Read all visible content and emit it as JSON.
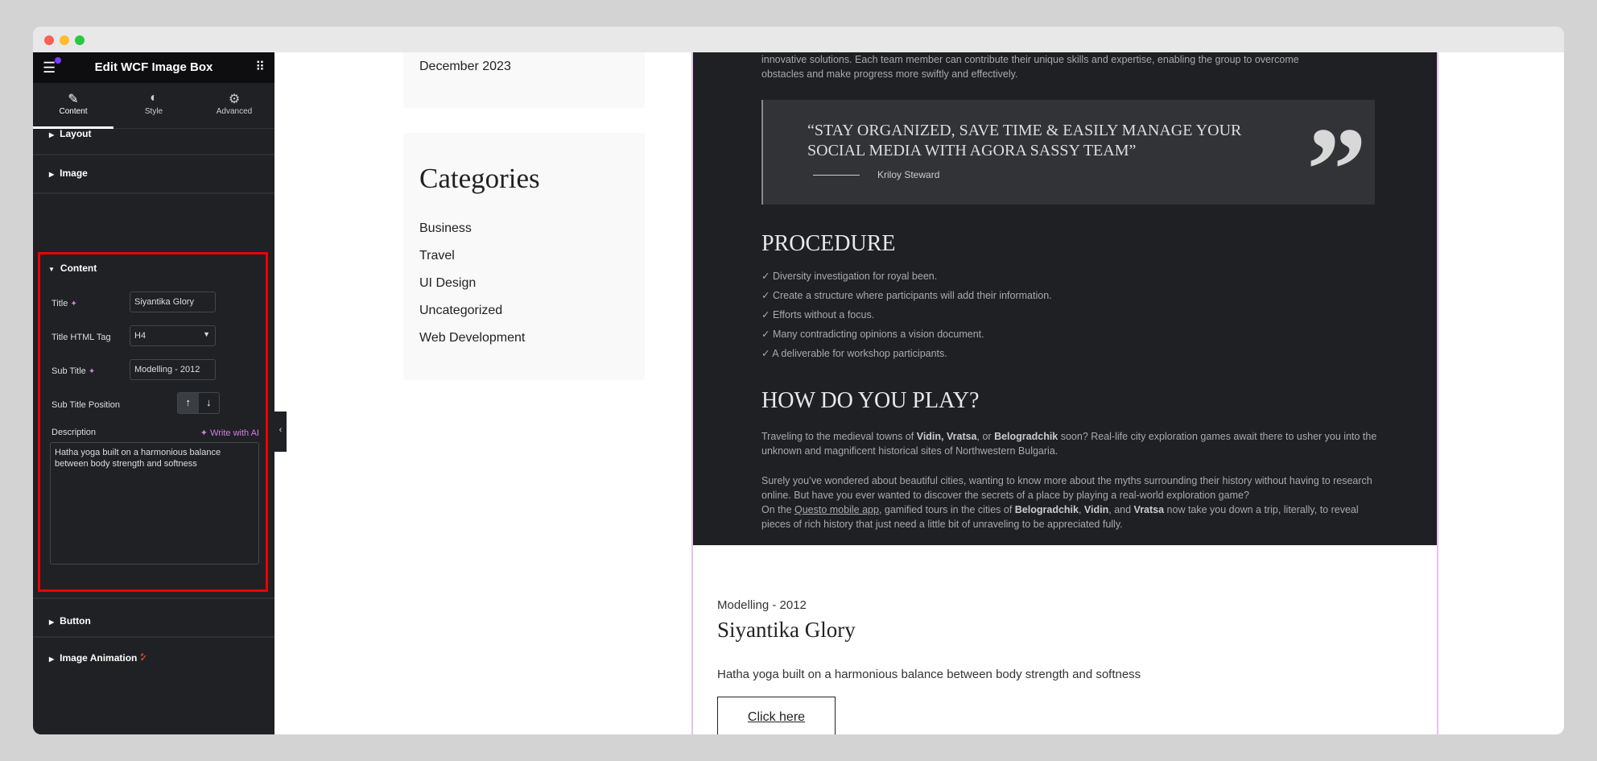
{
  "sidebar": {
    "title": "Edit WCF Image Box",
    "tabs": [
      {
        "label": "Content",
        "icon": "pencil-icon"
      },
      {
        "label": "Style",
        "icon": "contrast-icon"
      },
      {
        "label": "Advanced",
        "icon": "gear-icon"
      }
    ],
    "sections": {
      "layout": "Layout",
      "image": "Image",
      "content": "Content",
      "button": "Button",
      "image_animation": "Image Animation"
    },
    "fields": {
      "title_label": "Title",
      "title_value": "Siyantika Glory",
      "tag_label": "Title HTML Tag",
      "tag_value": "H4",
      "subtitle_label": "Sub Title",
      "subtitle_value": "Modelling - 2012",
      "position_label": "Sub Title Position",
      "description_label": "Description",
      "write_ai": "Write with AI",
      "description_value": "Hatha yoga built on a harmonious balance between body strength and softness"
    }
  },
  "widgets": {
    "archive_item": "December 2023",
    "categories_title": "Categories",
    "categories": [
      "Business",
      "Travel",
      "UI Design",
      "Uncategorized",
      "Web Development"
    ]
  },
  "image": {
    "intro_line1": "innovative solutions. Each team member can contribute their unique skills and expertise, enabling the group to overcome",
    "intro_line2": "obstacles and make progress more swiftly and effectively.",
    "quote": "“STAY ORGANIZED, SAVE TIME & EASILY MANAGE YOUR SOCIAL MEDIA WITH AGORA SASSY TEAM”",
    "quote_author": "Kriloy Steward",
    "procedure_title": "PROCEDURE",
    "procedure": [
      "Diversity investigation for royal been.",
      "Create a structure where participants will add their information.",
      "Efforts without a focus.",
      "Many contradicting opinions a vision document.",
      "A deliverable for workshop participants."
    ],
    "play_title": "HOW DO YOU PLAY?",
    "p1": {
      "a": "Traveling to the medieval towns of ",
      "b1": "Vidin, Vratsa",
      "c": ", or ",
      "b2": "Belogradchik",
      "d": " soon? Real-life city exploration games await there to usher you into the unknown and magnificent historical sites of Northwestern Bulgaria."
    },
    "p2": {
      "a": "Surely you’ve wondered about beautiful cities, wanting to know more about the myths surrounding their history without having to research online. But have you ever wanted to discover the secrets of a place by playing a real-world exploration game?",
      "b": "On the ",
      "link": "Questo mobile app",
      "c": ", gamified tours in the cities of ",
      "b1": "Belogradchik",
      "d": ", ",
      "b2": "Vidin",
      "e": ", and ",
      "b3": "Vratsa",
      "f": " now take you down a trip, literally, to reveal pieces of rich history that just need a little bit of unraveling to be appreciated fully."
    }
  },
  "card": {
    "subtitle": "Modelling - 2012",
    "title": "Siyantika Glory",
    "description": "Hatha yoga built on a harmonious balance between body strength and softness",
    "button": "Click here"
  },
  "colors": {
    "highlight": "#e00000",
    "ai_accent": "#d57de0",
    "notification_dot": "#7b3cff"
  }
}
